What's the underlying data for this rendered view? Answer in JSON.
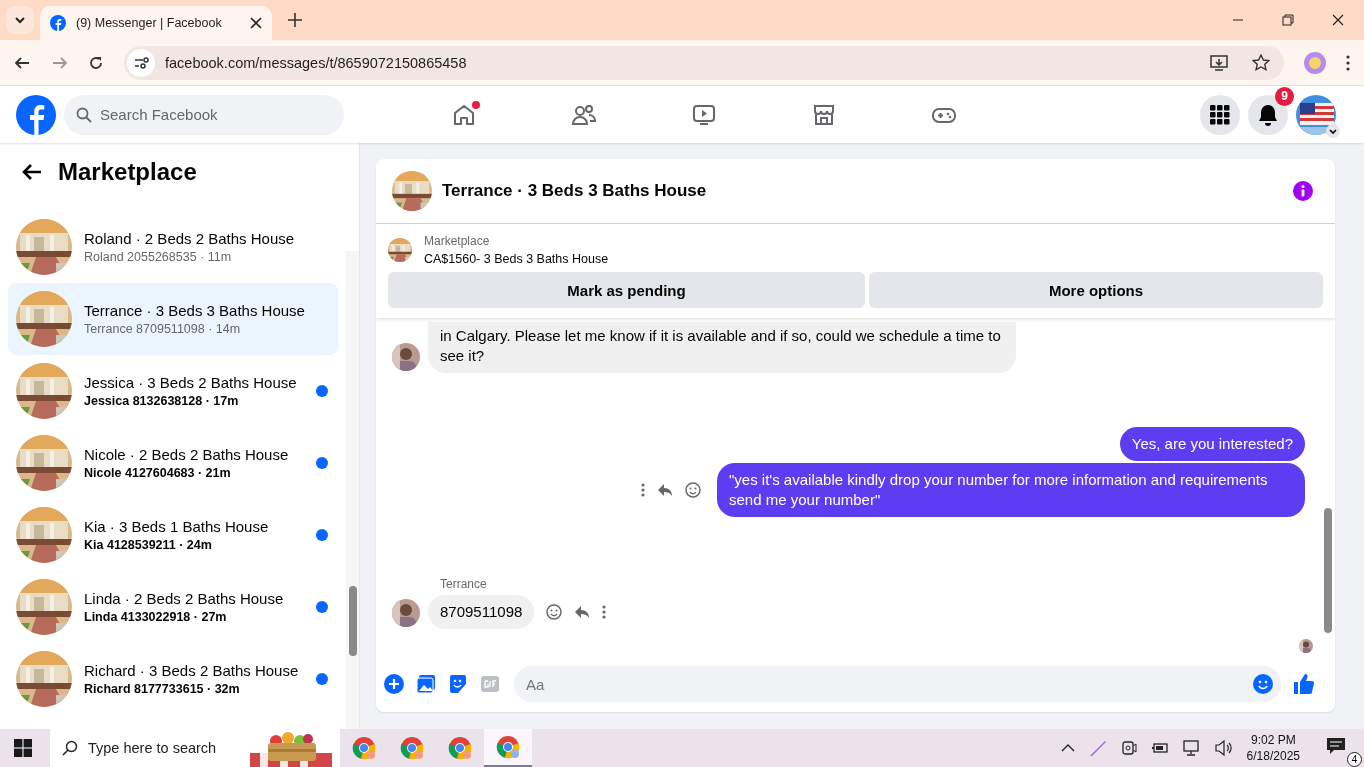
{
  "browser": {
    "tab_title": "(9) Messenger | Facebook",
    "url": "facebook.com/messages/t/8659072150865458"
  },
  "facebook": {
    "search_placeholder": "Search Facebook",
    "notification_count": "9",
    "nav": [
      {
        "kind": "home",
        "notify": true
      },
      {
        "kind": "friends",
        "notify": false
      },
      {
        "kind": "video",
        "notify": false
      },
      {
        "kind": "marketplace",
        "notify": false
      },
      {
        "kind": "gaming",
        "notify": false
      }
    ]
  },
  "sidebar": {
    "title": "Marketplace",
    "conversations": [
      {
        "title": "Roland · 2 Beds 2 Baths House",
        "subtitle": "Roland 2055268535 · 11m",
        "selected": false,
        "unread": false
      },
      {
        "title": "Terrance · 3 Beds 3 Baths House",
        "subtitle": "Terrance 8709511098 · 14m",
        "selected": true,
        "unread": false
      },
      {
        "title": "Jessica · 3 Beds 2 Baths House",
        "subtitle": "Jessica 8132638128 · 17m",
        "selected": false,
        "unread": true
      },
      {
        "title": "Nicole · 2 Beds 2 Baths House",
        "subtitle": "Nicole 4127604683 · 21m",
        "selected": false,
        "unread": true
      },
      {
        "title": "Kia · 3 Beds 1 Baths House",
        "subtitle": "Kia 4128539211 · 24m",
        "selected": false,
        "unread": true
      },
      {
        "title": "Linda · 2 Beds 2 Baths House",
        "subtitle": "Linda 4133022918 · 27m",
        "selected": false,
        "unread": true
      },
      {
        "title": "Richard · 3 Beds 2 Baths House",
        "subtitle": "Richard 8177733615 · 32m",
        "selected": false,
        "unread": true
      }
    ]
  },
  "chat": {
    "title": "Terrance · 3 Beds 3 Baths House",
    "listing": {
      "label": "Marketplace",
      "title": "CA$1560- 3 Beds 3 Baths House"
    },
    "buttons": [
      "Mark as pending",
      "More options"
    ],
    "messages": [
      {
        "kind": "received",
        "text": "in Calgary. Please let me know if it is available and if so, could we schedule a time to see it?",
        "hover": false
      },
      {
        "kind": "sent",
        "text": "Yes, are you interested?",
        "hover": false
      },
      {
        "kind": "sent",
        "text": "\"yes it's available kindly drop your number for more information and requirements send me your number\"",
        "hover": true
      },
      {
        "kind": "received",
        "sender": "Terrance",
        "text": "8709511098",
        "hover": true
      }
    ],
    "composer_placeholder": "Aa"
  },
  "taskbar": {
    "search_placeholder": "Type here to search",
    "apps": [
      {
        "selected": false
      },
      {
        "selected": false
      },
      {
        "selected": false
      },
      {
        "selected": true
      }
    ],
    "time": "9:02 PM",
    "date": "6/18/2025",
    "notification_count": "4"
  }
}
